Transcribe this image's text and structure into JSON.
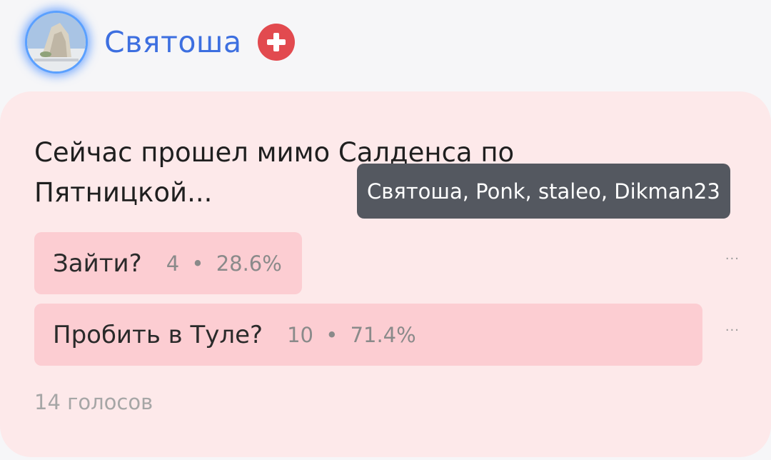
{
  "author": {
    "name": "Святоша",
    "avatar_icon": "avatar-photo-icon",
    "badge_icon": "plus-cross-icon",
    "accent_color": "#3d6fe0",
    "badge_color": "#e24a4f"
  },
  "poll": {
    "question": "Сейчас прошел мимо Салденса по Пятницкой...",
    "options": [
      {
        "label": "Зайти?",
        "count": "4",
        "separator": "•",
        "percent": "28.6%",
        "share": 0.286
      },
      {
        "label": "Пробить в Туле?",
        "count": "10",
        "separator": "•",
        "percent": "71.4%",
        "share": 0.714
      }
    ],
    "more_label": "···",
    "total_votes": "14 голосов",
    "card_color": "#fde9ea",
    "bar_color": "#fccdd2"
  },
  "tooltip": {
    "text": "Святоша, Ponk, staleo, Dikman23"
  }
}
